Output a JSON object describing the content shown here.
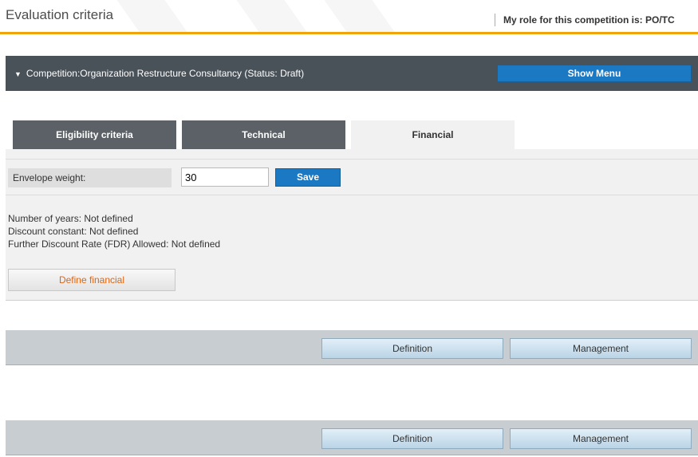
{
  "header": {
    "title": "Evaluation criteria",
    "role_text": "My role for this competition is: PO/TC"
  },
  "competition": {
    "title": "Competition:Organization Restructure Consultancy (Status: Draft)",
    "show_menu_label": "Show Menu"
  },
  "tabs": [
    {
      "label": "Eligibility criteria",
      "active": false
    },
    {
      "label": "Technical",
      "active": false
    },
    {
      "label": "Financial",
      "active": true
    }
  ],
  "envelope": {
    "label": "Envelope weight:",
    "value": "30",
    "save_label": "Save"
  },
  "financial_info": {
    "years": "Number of years: Not defined",
    "discount": "Discount constant: Not defined",
    "fdr": "Further Discount Rate (FDR) Allowed: Not defined",
    "define_label": "Define financial"
  },
  "action_bars": [
    {
      "definition_label": "Definition",
      "management_label": "Management"
    },
    {
      "definition_label": "Definition",
      "management_label": "Management"
    }
  ],
  "colors": {
    "accent": "#f0a30a",
    "primary_button": "#1b78c2",
    "competition_bar": "#4a5259",
    "link_orange": "#e2640e"
  },
  "icons": {
    "competition_toggle": "chevron-down-icon"
  }
}
